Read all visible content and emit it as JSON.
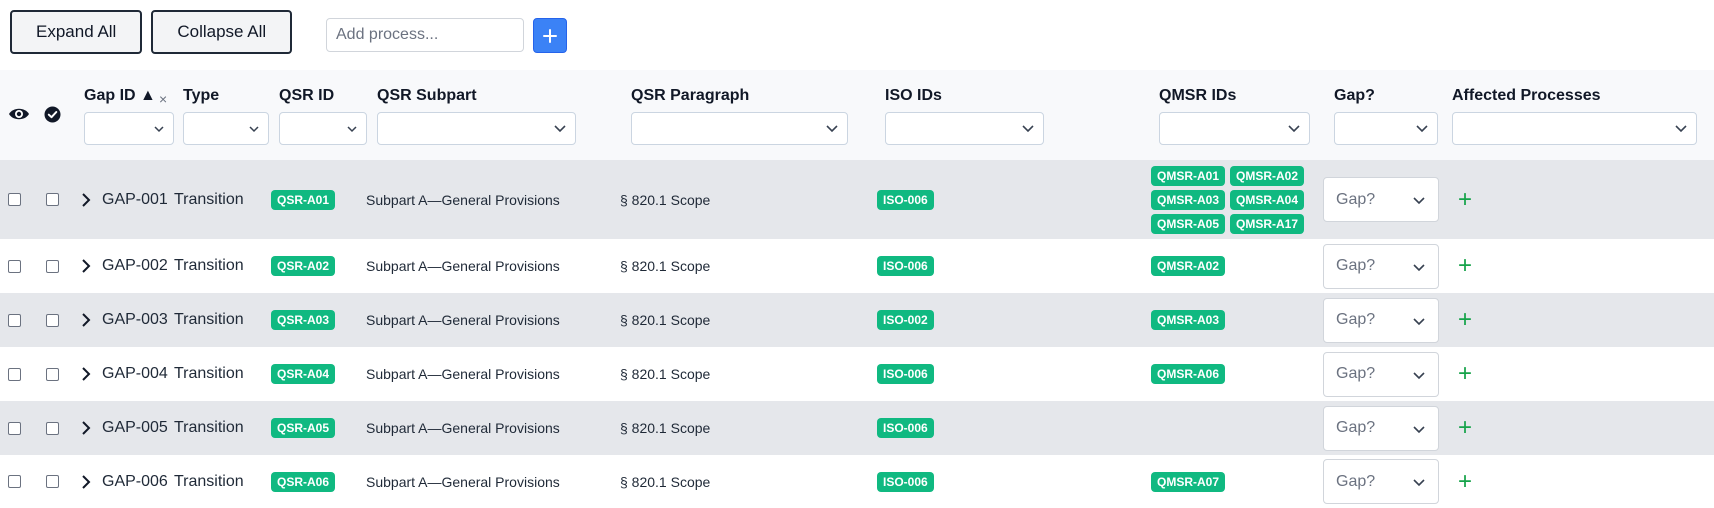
{
  "toolbar": {
    "expand_all": "Expand All",
    "collapse_all": "Collapse All",
    "add_process_placeholder": "Add process...",
    "add_button_icon": "plus-icon"
  },
  "columns": {
    "gap_id": "Gap ID",
    "sort_indicator": "▲",
    "clear": "×",
    "type": "Type",
    "qsr_id": "QSR ID",
    "qsr_subpart": "QSR Subpart",
    "qsr_paragraph": "QSR Paragraph",
    "iso_ids": "ISO IDs",
    "qmsr_ids": "QMSR IDs",
    "gap": "Gap?",
    "affected_processes": "Affected Processes",
    "visibility_icon": "eye-icon",
    "select_all_icon": "check-circle-icon"
  },
  "gap_select_placeholder": "Gap?",
  "add_process_icon": "plus-icon",
  "colors": {
    "badge": "#10b981",
    "row_alt": "#e5e7eb",
    "accent": "#3b82f6",
    "plus": "#16a34a"
  },
  "rows": [
    {
      "id": "GAP-001",
      "type": "Transition",
      "qsr_id": "QSR-A01",
      "subpart": "Subpart A—General Provisions",
      "paragraph": "§ 820.1 Scope",
      "iso": "ISO-006",
      "qmsr": [
        "QMSR-A01",
        "QMSR-A02",
        "QMSR-A03",
        "QMSR-A04",
        "QMSR-A05",
        "QMSR-A17"
      ],
      "add": "+"
    },
    {
      "id": "GAP-002",
      "type": "Transition",
      "qsr_id": "QSR-A02",
      "subpart": "Subpart A—General Provisions",
      "paragraph": "§ 820.1 Scope",
      "iso": "ISO-006",
      "qmsr": [
        "QMSR-A02"
      ],
      "add": "+"
    },
    {
      "id": "GAP-003",
      "type": "Transition",
      "qsr_id": "QSR-A03",
      "subpart": "Subpart A—General Provisions",
      "paragraph": "§ 820.1 Scope",
      "iso": "ISO-002",
      "qmsr": [
        "QMSR-A03"
      ],
      "add": "+"
    },
    {
      "id": "GAP-004",
      "type": "Transition",
      "qsr_id": "QSR-A04",
      "subpart": "Subpart A—General Provisions",
      "paragraph": "§ 820.1 Scope",
      "iso": "ISO-006",
      "qmsr": [
        "QMSR-A06"
      ],
      "add": "+"
    },
    {
      "id": "GAP-005",
      "type": "Transition",
      "qsr_id": "QSR-A05",
      "subpart": "Subpart A—General Provisions",
      "paragraph": "§ 820.1 Scope",
      "iso": "ISO-006",
      "qmsr": [],
      "add": "+"
    },
    {
      "id": "GAP-006",
      "type": "Transition",
      "qsr_id": "QSR-A06",
      "subpart": "Subpart A—General Provisions",
      "paragraph": "§ 820.1 Scope",
      "iso": "ISO-006",
      "qmsr": [
        "QMSR-A07"
      ],
      "add": "+"
    }
  ]
}
